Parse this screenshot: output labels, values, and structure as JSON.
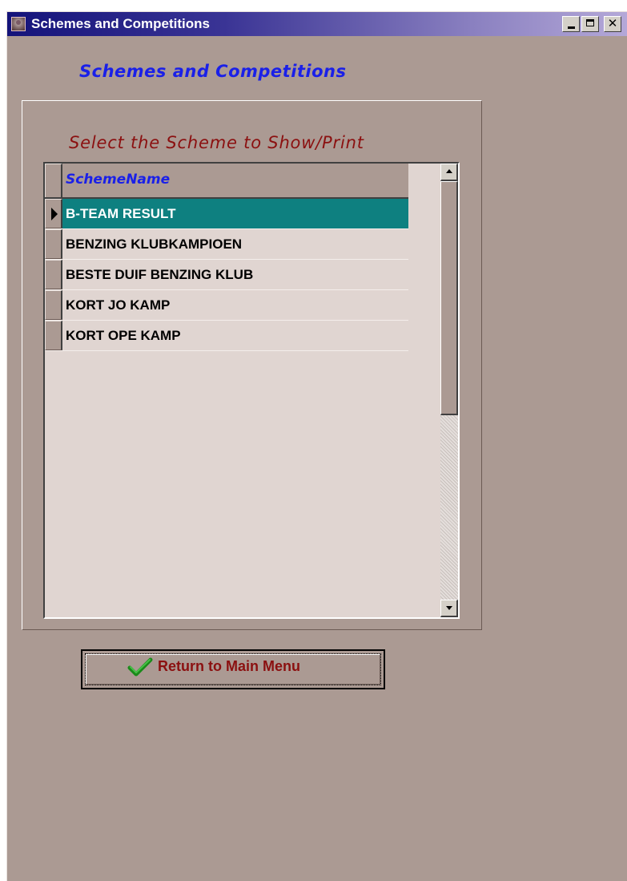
{
  "window": {
    "title": "Schemes and Competitions"
  },
  "heading": "Schemes and Competitions",
  "panel": {
    "caption": "Select the Scheme to Show/Print"
  },
  "grid": {
    "column_header": "SchemeName",
    "rows": [
      {
        "label": "B-TEAM RESULT",
        "selected": true
      },
      {
        "label": "BENZING KLUBKAMPIOEN",
        "selected": false
      },
      {
        "label": "BESTE DUIF BENZING KLUB",
        "selected": false
      },
      {
        "label": "KORT JO KAMP",
        "selected": false
      },
      {
        "label": "KORT OPE KAMP",
        "selected": false
      }
    ]
  },
  "actions": {
    "return_label": "Return to Main Menu"
  },
  "colors": {
    "window_bg": "#ab9a93",
    "heading": "#1a20e8",
    "caption": "#8b1010",
    "selected_row": "#0e8080",
    "button_text": "#8b1010"
  },
  "icons": {
    "app": "app-icon",
    "return": "checkmark-icon"
  }
}
